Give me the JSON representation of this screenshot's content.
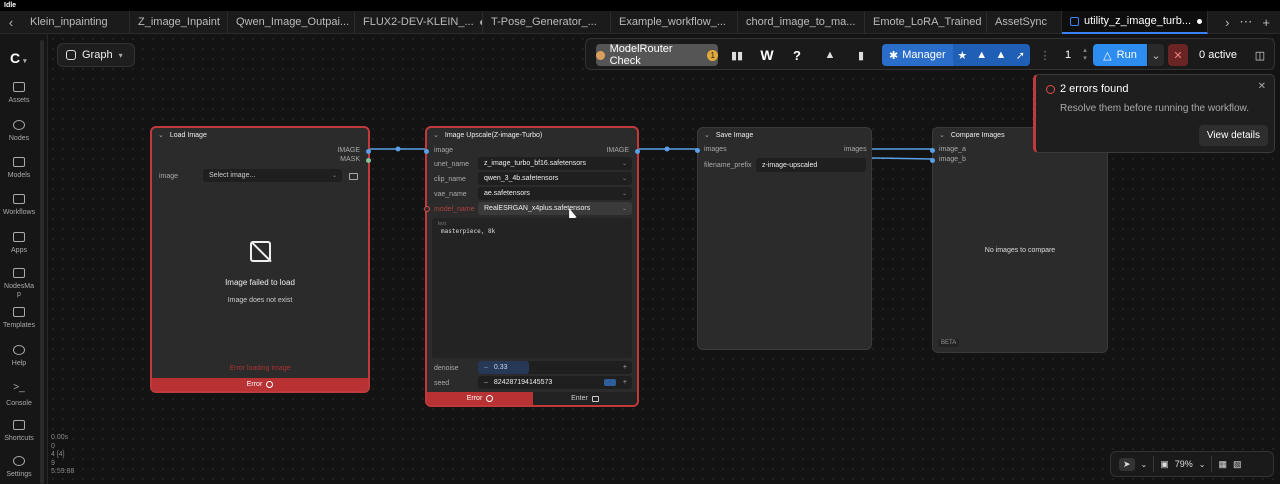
{
  "app": {
    "title": "Idle"
  },
  "tabs": [
    {
      "label": "Klein_inpainting",
      "dot": false
    },
    {
      "label": "Z_image_Inpaint",
      "dot": false
    },
    {
      "label": "Qwen_Image_Outpai...",
      "dot": true
    },
    {
      "label": "FLUX2-DEV-KLEIN_...",
      "dot": true
    },
    {
      "label": "T-Pose_Generator_...",
      "dot": false
    },
    {
      "label": "Example_workflow_...",
      "dot": false
    },
    {
      "label": "chord_image_to_ma...",
      "dot": false
    },
    {
      "label": "Emote_LoRA_Trained",
      "dot": false
    },
    {
      "label": "AssetSync",
      "dot": false
    },
    {
      "label": "utility_z_image_turb...",
      "dot": true,
      "active": true
    }
  ],
  "sidebar": {
    "items": [
      {
        "label": "Assets"
      },
      {
        "label": "Nodes"
      },
      {
        "label": "Models"
      },
      {
        "label": "Workflows"
      },
      {
        "label": "Apps"
      },
      {
        "label": "NodesMa",
        "label2": "p"
      },
      {
        "label": "Templates"
      },
      {
        "label": "Help"
      },
      {
        "label": "Console"
      },
      {
        "label": "Shortcuts"
      },
      {
        "label": "Settings"
      }
    ]
  },
  "stats": {
    "line1": "0.00s",
    "line2": "0",
    "line3": "4 [4]",
    "line4": "9",
    "line5": "5:59:88"
  },
  "graph": {
    "label": "Graph"
  },
  "toolbar": {
    "modelrouter_label": "ModelRouter Check",
    "modelrouter_badge": "1",
    "help_label": "?",
    "w_label": "W",
    "manager_label": "Manager",
    "batch_count": "1",
    "run_label": "Run",
    "active_label": "0 active"
  },
  "nodes": {
    "load_image": {
      "title": "Load Image",
      "out_image": "IMAGE",
      "out_mask": "MASK",
      "image_label": "image",
      "image_value": "Select image...",
      "failed_title": "Image failed to load",
      "failed_sub": "Image does not exist",
      "error_loading": "Error loading image",
      "error_label": "Error"
    },
    "upscale": {
      "title": "Image Upscale(Z-image-Turbo)",
      "in_image": "image",
      "out_image": "IMAGE",
      "unet_label": "unet_name",
      "unet_value": "z_image_turbo_bf16.safetensors",
      "clip_label": "clip_name",
      "clip_value": "qwen_3_4b.safetensors",
      "vae_label": "vae_name",
      "vae_value": "ae.safetensors",
      "model_label": "model_name",
      "model_value": "RealESRGAN_x4plus.safetensors",
      "text_label": "text",
      "text_value": "masterpiece, 8k",
      "denoise_label": "denoise",
      "denoise_value": "0.33",
      "seed_label": "seed",
      "seed_value": "824287194145573",
      "error_label": "Error",
      "enter_label": "Enter"
    },
    "save_image": {
      "title": "Save Image",
      "in_images": "images",
      "prefix_label": "filename_prefix",
      "prefix_value": "z-image-upscaled"
    },
    "compare": {
      "title": "Compare Images",
      "in_a": "image_a",
      "in_b": "image_b",
      "out_images": "images",
      "empty": "No images to compare",
      "beta": "BETA"
    }
  },
  "toast": {
    "title": "2 errors found",
    "message": "Resolve them before running the workflow.",
    "action": "View details"
  },
  "zoom": {
    "level": "79%"
  },
  "colors": {
    "error": "#c0393b",
    "accent": "#3b82f6",
    "link": "#5aa0e6"
  }
}
